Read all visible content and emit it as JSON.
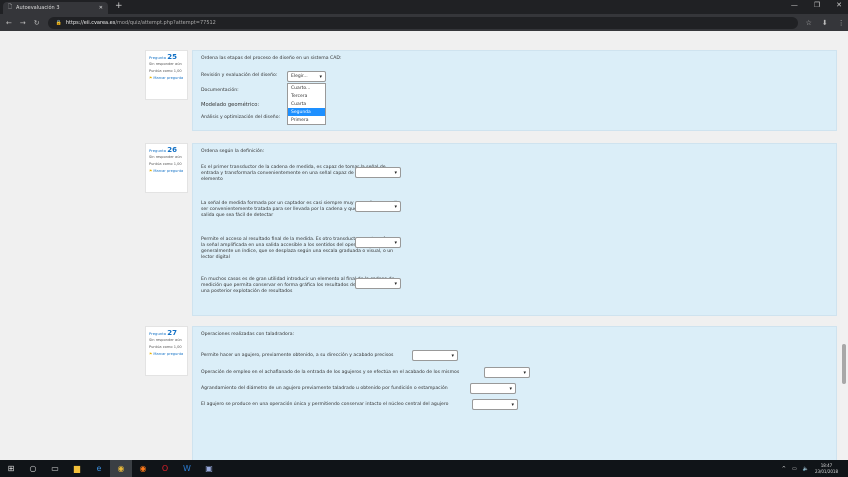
{
  "browser": {
    "tab_title": "Autoevaluación 3",
    "url_host": "https://eii.cvarea.es",
    "url_path": "/mod/quiz/attempt.php?attempt=77512"
  },
  "questions": [
    {
      "number": "25",
      "label": "Pregunta",
      "status": "Sin responder aún",
      "score": "Puntúa como 1,00",
      "flag": "Marcar pregunta",
      "prompt": "Ordena las etapas del proceso de diseño en un sistema CAD:",
      "items": [
        "Revisión y evaluación del diseño:",
        "Documentación:",
        "Modelado geométrico:",
        "Análisis y optimización del diseño:"
      ],
      "first_select": "Elegir...",
      "dropdown_options": [
        "Cuarto...",
        "Tercera",
        "Cuarta",
        "Segunda",
        "Primera"
      ],
      "dropdown_selected": "Segunda"
    },
    {
      "number": "26",
      "label": "Pregunta",
      "status": "Sin responder aún",
      "score": "Puntúa como 1,00",
      "flag": "Marcar pregunta",
      "prompt": "Ordena según la definición:",
      "items": [
        "Es el primer transductor de la cadena de medida, es capaz de tomar la señal de entrada y transformarla convenientemente en una señal capaz de actuar al siguiente elemento",
        "La señal de medida formada por un captador es casi siempre muy pequeña y necesita ser convenientemente tratada para ser llevada por la cadena y que dé una señal de salida que sea fácil de detectar",
        "Permite el acceso al resultado final de la medida. Es otro transductor que transforma la señal amplificada en una salida accesible a los sentidos del operador, generalmente un índice, que se desplaza según una escala graduada o visual, o un lector digital",
        "En muchos casos es de gran utilidad introducir un elemento al final de la cadena de medición que permita conservar en forma gráfica los resultados de la medición para una posterior explotación de resultados"
      ]
    },
    {
      "number": "27",
      "label": "Pregunta",
      "status": "Sin responder aún",
      "score": "Puntúa como 1,00",
      "flag": "Marcar pregunta",
      "prompt": "Operaciones realizadas con taladradora:",
      "items": [
        "Permite hacer un agujero, previamente obtenido, a su dirección y acabado precisos",
        "Operación de empleo en el achaflanado de la entrada de los agujeros y se efectúa en el acabado de los mismos",
        "Agrandamiento del diámetro de un agujero previamente taladrado u obtenido por fundición o estampación",
        "El agujero se produce en una operación única y permitiendo conservar intacto el núcleo central del agujero"
      ]
    }
  ],
  "taskbar": {
    "time": "18:47",
    "date": "23/01/2018"
  }
}
